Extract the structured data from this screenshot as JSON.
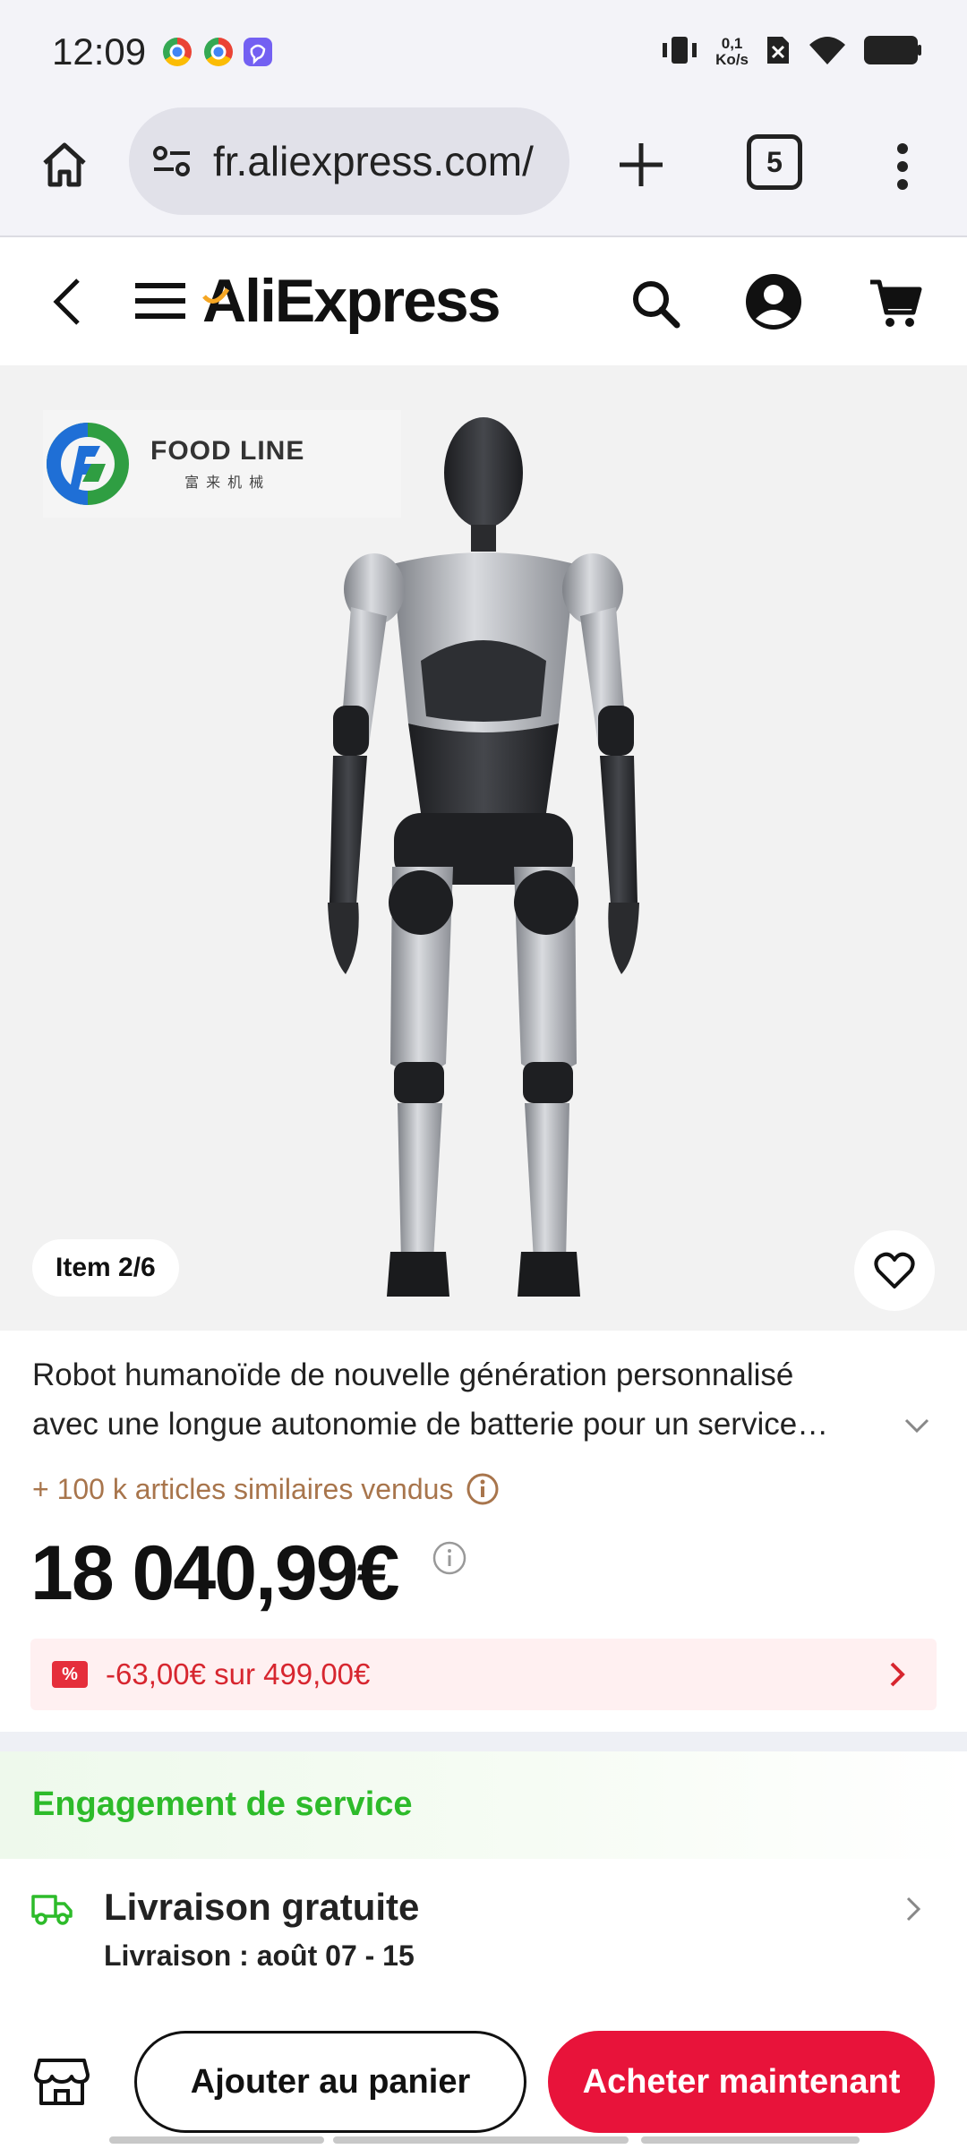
{
  "status_bar": {
    "time": "12:09",
    "net_speed_value": "0,1",
    "net_speed_unit": "Ko/s"
  },
  "browser": {
    "url": "fr.aliexpress.com/",
    "tab_count": "5"
  },
  "header": {
    "logo": "AliExpress"
  },
  "product": {
    "brand_name": "FOOD LINE",
    "brand_sub": "富来机械",
    "image_counter": "Item 2/6",
    "title_line1": "Robot humanoïde de nouvelle génération personnalisé",
    "title_line2": "avec une longue autonomie de batterie pour un service…",
    "sold": "+ 100 k articles similaires vendus",
    "price": "18 040,99€",
    "coupon_badge": "%",
    "coupon": "-63,00€ sur 499,00€"
  },
  "service": {
    "title": "Engagement de service",
    "delivery_title": "Livraison gratuite",
    "delivery_sub": "Livraison : août 07 - 15"
  },
  "actions": {
    "add_to_cart": "Ajouter au panier",
    "buy_now": "Acheter maintenant"
  },
  "colors": {
    "accent_red": "#e8133a",
    "service_green": "#2dbb2a",
    "sold_brown": "#a8754c"
  }
}
